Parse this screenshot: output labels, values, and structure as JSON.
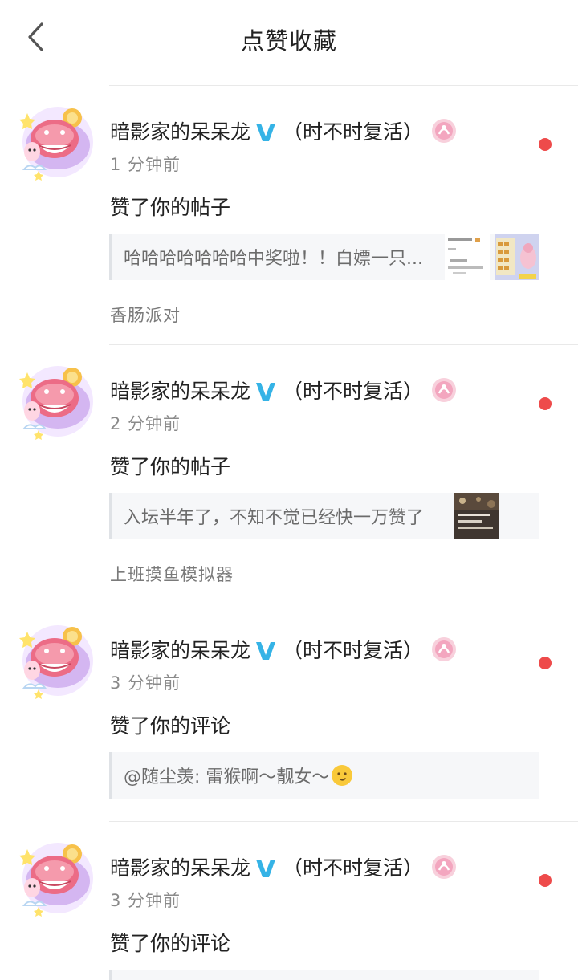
{
  "header": {
    "title": "点赞收藏",
    "back_icon": "chevron-left-icon"
  },
  "colors": {
    "unread_dot": "#ee4b4b",
    "verified_badge": "#35b3e6",
    "level_badge": "#f3a6bf"
  },
  "items": [
    {
      "username": "暗影家的呆呆龙",
      "username_suffix": "（时不时复活）",
      "time": "1 分钟前",
      "action": "赞了你的帖子",
      "quote": "哈哈哈哈哈哈哈中奖啦！！白嫖一只...",
      "forum": "香肠派对",
      "has_thumbs": 2
    },
    {
      "username": "暗影家的呆呆龙",
      "username_suffix": "（时不时复活）",
      "time": "2 分钟前",
      "action": "赞了你的帖子",
      "quote": "入坛半年了，不知不觉已经快一万赞了",
      "forum": "上班摸鱼模拟器",
      "has_thumbs": 1
    },
    {
      "username": "暗影家的呆呆龙",
      "username_suffix": "（时不时复活）",
      "time": "3 分钟前",
      "action": "赞了你的评论",
      "quote": "@随尘羡: 雷猴啊～靓女～",
      "emoji": "smirk-face-emoji"
    },
    {
      "username": "暗影家的呆呆龙",
      "username_suffix": "（时不时复活）",
      "time": "3 分钟前",
      "action": "赞了你的评论"
    }
  ]
}
